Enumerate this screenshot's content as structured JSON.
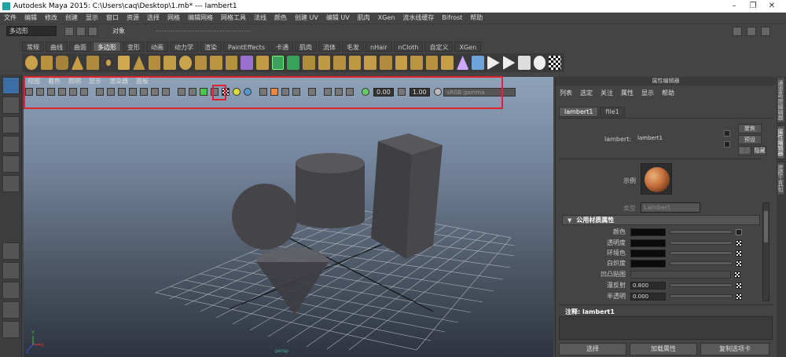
{
  "window": {
    "title": "Autodesk Maya 2015: C:\\Users\\caq\\Desktop\\1.mb*   ---   lambert1",
    "minimize": "–",
    "maximize": "❐",
    "close": "✕"
  },
  "menubar": [
    "文件",
    "编辑",
    "修改",
    "创建",
    "显示",
    "窗口",
    "资源",
    "选择",
    "网格",
    "编辑网格",
    "网格工具",
    "法线",
    "颜色",
    "创建 UV",
    "编辑 UV",
    "肌肉",
    "XGen",
    "流水线缓存",
    "Bifrost",
    "帮助"
  ],
  "statusline": {
    "menuset": "多边形",
    "objects_label": "对象"
  },
  "shelf_tabs": [
    "常规",
    "曲线",
    "曲面",
    "多边形",
    "变形",
    "动画",
    "动力学",
    "渲染",
    "PaintEffects",
    "卡通",
    "肌肉",
    "流体",
    "毛发",
    "nHair",
    "nCloth",
    "自定义",
    "XGen"
  ],
  "shelf_active": "多边形",
  "viewport": {
    "menu": [
      "视图",
      "着色",
      "照明",
      "显示",
      "渲染器",
      "面板"
    ],
    "exposure": "0.00",
    "gamma": "1.00",
    "color_space": "sRGB gamma",
    "axis_x": "X",
    "axis_y": "Y",
    "axis_z": "Z",
    "caption": "persp"
  },
  "attribute_editor": {
    "title": "属性编辑器",
    "menu": [
      "列表",
      "选定",
      "关注",
      "属性",
      "显示",
      "帮助"
    ],
    "tabs": [
      "lambert1",
      "file1"
    ],
    "active_tab": "lambert1",
    "node_label": "lambert:",
    "node_value": "lambert1",
    "focus_btn": "聚焦",
    "preset_btn": "预设",
    "show_btn": "显示",
    "hide_btn": "隐藏",
    "sample_label": "示例",
    "type_label": "类型",
    "type_value": "Lambert",
    "section": "公用材质属性",
    "attrs": {
      "color": "颜色",
      "transparency": "透明度",
      "ambient": "环境色",
      "incandescence": "白炽度",
      "bump": "凹凸贴图",
      "diffuse": "漫反射",
      "diffuse_value": "0.800",
      "translucence": "半透明",
      "translucence_value": "0.000"
    },
    "notes_label": "注释: lambert1",
    "select_btn": "选择",
    "load_btn": "加载属性",
    "copy_btn": "复制选项卡"
  },
  "vertical_tabs": [
    "通道盒/层编辑器",
    "属性编辑器",
    "建模工具包"
  ],
  "colors": {
    "accent_red": "#e3222c",
    "background": "#444444",
    "swatch": "#0b0b0b"
  }
}
